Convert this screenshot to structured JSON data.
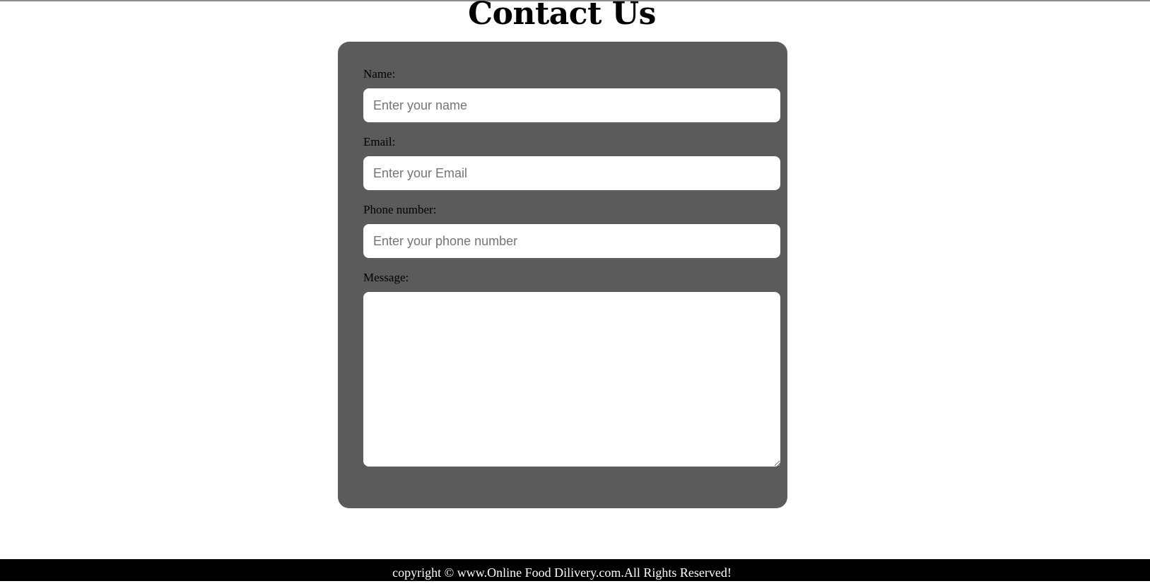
{
  "page": {
    "title": "Contact Us"
  },
  "form": {
    "name": {
      "label": "Name:",
      "placeholder": "Enter your name",
      "value": ""
    },
    "email": {
      "label": "Email:",
      "placeholder": "Enter your Email",
      "value": ""
    },
    "phone": {
      "label": "Phone number:",
      "placeholder": "Enter your phone number",
      "value": ""
    },
    "message": {
      "label": "Message:",
      "value": ""
    }
  },
  "footer": {
    "text": "copyright © www.Online Food Dilivery.com.All Rights Reserved!"
  },
  "colors": {
    "card_background": "#5b5b5b",
    "footer_background": "#000000",
    "input_background": "#ffffff"
  }
}
